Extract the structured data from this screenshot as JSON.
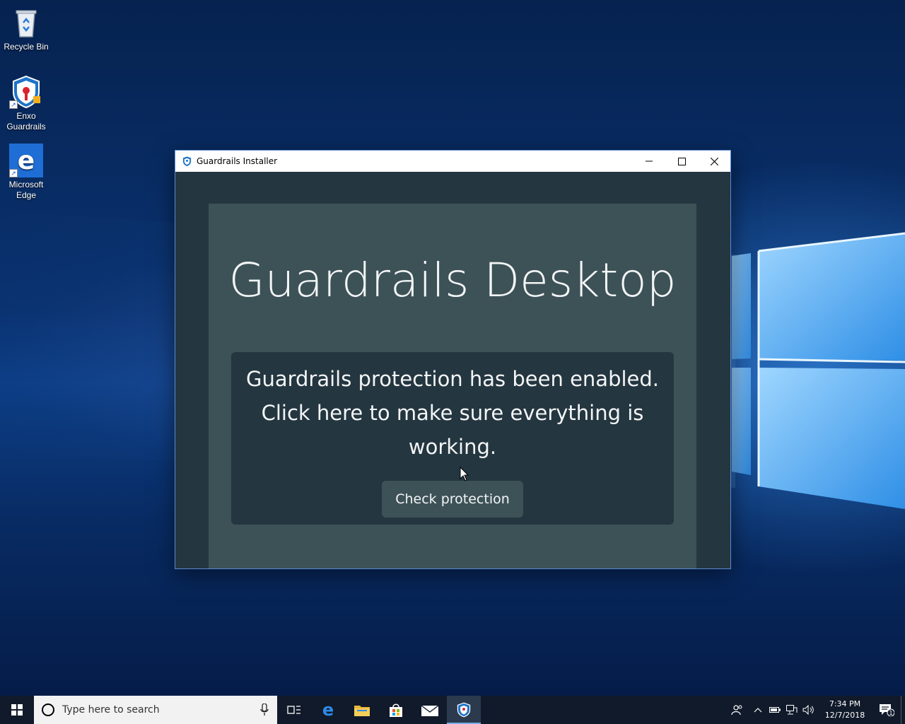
{
  "desktop": {
    "icons": [
      {
        "label": "Recycle Bin",
        "icon": "recycle-bin-icon"
      },
      {
        "label": "Enxo\nGuardrails",
        "icon": "guardrails-shield-icon"
      },
      {
        "label": "Microsoft\nEdge",
        "icon": "edge-icon"
      }
    ]
  },
  "window": {
    "title": "Guardrails Installer",
    "app_title": "Guardrails Desktop",
    "message": "Guardrails protection has been enabled. Click here to make sure everything is working.",
    "check_button_label": "Check protection"
  },
  "taskbar": {
    "search_placeholder": "Type here to search",
    "apps": [
      "task-view-icon",
      "edge-icon",
      "file-explorer-icon",
      "store-icon",
      "mail-icon",
      "guardrails-shield-icon"
    ],
    "clock_time": "7:34 PM",
    "clock_date": "12/7/2018",
    "notification_count": "1"
  },
  "colors": {
    "window_bg": "#243640",
    "panel_bg": "#3d5257",
    "taskbar_bg": "#101a2a"
  }
}
